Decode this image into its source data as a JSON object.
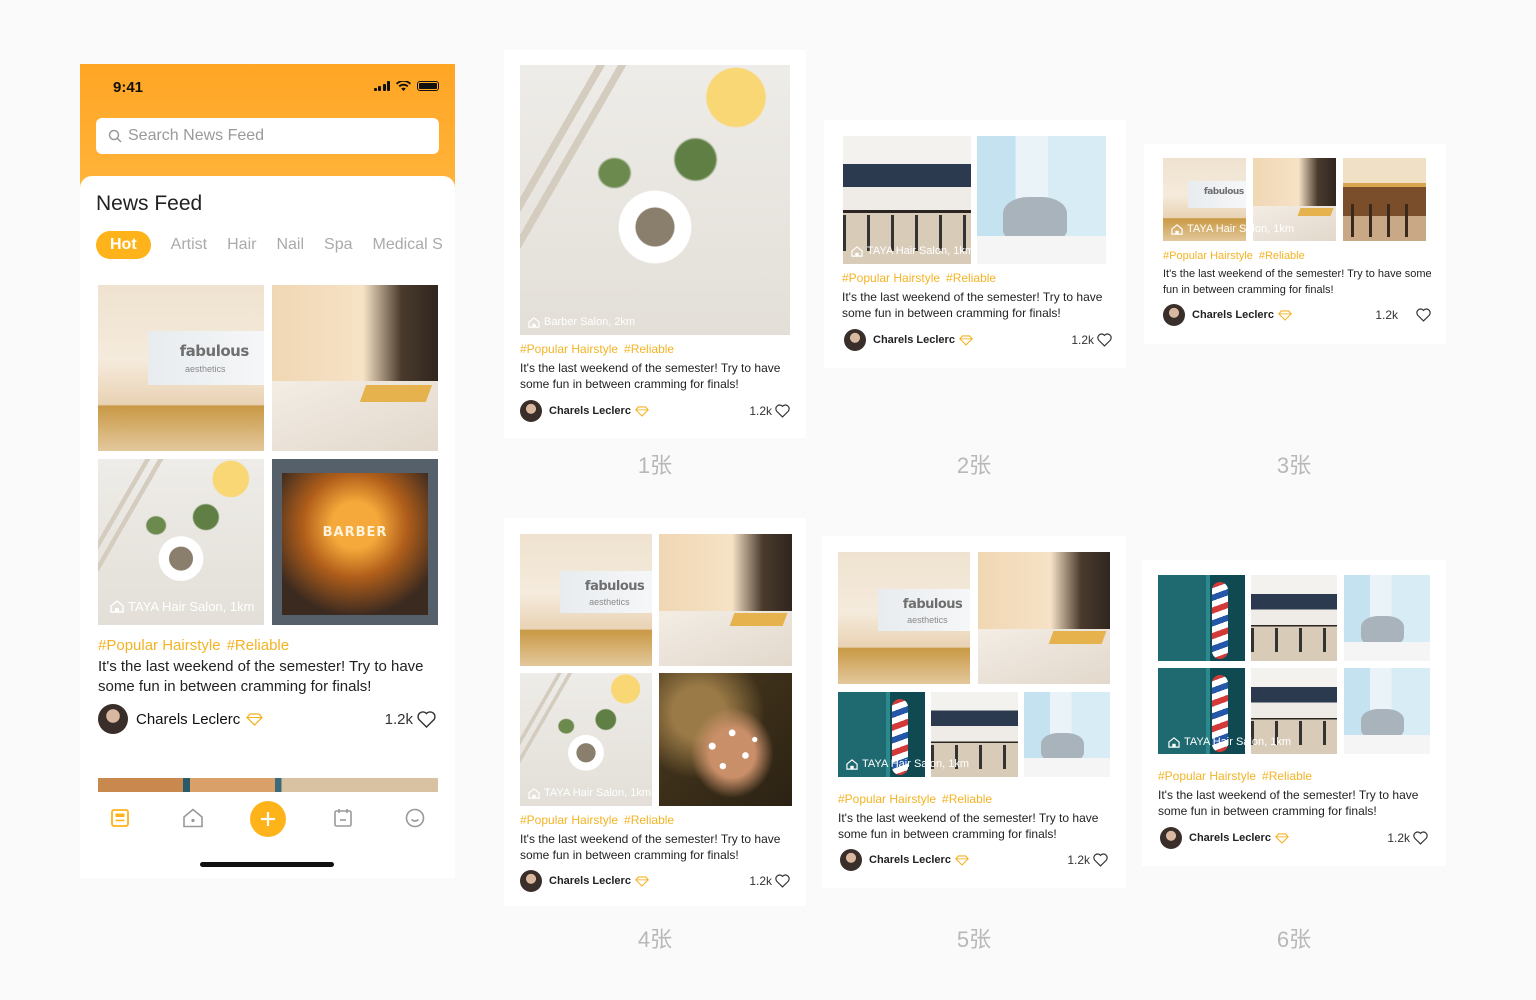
{
  "status_bar": {
    "time": "9:41"
  },
  "search": {
    "placeholder": "Search News Feed"
  },
  "feed": {
    "title": "News Feed",
    "tabs": [
      "Hot",
      "Artist",
      "Hair",
      "Nail",
      "Spa",
      "Medical S"
    ],
    "active_tab": "Hot"
  },
  "post": {
    "location": "TAYA Hair Salon, 1km",
    "tags": [
      "#Popular Hairstyle",
      "#Reliable"
    ],
    "text": "It's the last weekend of the semester! Try to have some fun in between cramming for finals!",
    "author": "Charels Leclerc",
    "likes": "1.2k"
  },
  "image_text": {
    "fabulous": "fabulous",
    "aesthetics": "aesthetics",
    "barber": "BARBER"
  },
  "bottom_nav": {
    "items": [
      {
        "name": "news-icon",
        "active": true
      },
      {
        "name": "home-icon",
        "active": false
      },
      {
        "name": "plus-icon",
        "active": false
      },
      {
        "name": "calendar-icon",
        "active": false
      },
      {
        "name": "smile-icon",
        "active": false
      }
    ]
  },
  "cards": [
    {
      "caption": "1张",
      "location": "Barber Salon, 2km",
      "tags": [
        "#Popular Hairstyle",
        "#Reliable"
      ],
      "text": "It's the last weekend of the semester! Try to have some fun in between cramming for finals!",
      "author": "Charels Leclerc",
      "likes": "1.2k"
    },
    {
      "caption": "2张",
      "location": "TAYA Hair Salon, 1km",
      "tags": [
        "#Popular Hairstyle",
        "#Reliable"
      ],
      "text": "It's the last weekend of the semester! Try to have some fun in between cramming for finals!",
      "author": "Charels Leclerc",
      "likes": "1.2k"
    },
    {
      "caption": "3张",
      "location": "TAYA Hair Salon, 1km",
      "tags": [
        "#Popular Hairstyle",
        "#Reliable"
      ],
      "text": "It's the last weekend of the semester! Try to have some fun in between cramming for finals!",
      "author": "Charels Leclerc",
      "likes": "1.2k"
    },
    {
      "caption": "4张",
      "location": "TAYA Hair Salon, 1km",
      "tags": [
        "#Popular Hairstyle",
        "#Reliable"
      ],
      "text": "It's the last weekend of the semester! Try to have some fun in between cramming for finals!",
      "author": "Charels Leclerc",
      "likes": "1.2k"
    },
    {
      "caption": "5张",
      "location": "TAYA Hair Salon, 1km",
      "tags": [
        "#Popular Hairstyle",
        "#Reliable"
      ],
      "text": "It's the last weekend of the semester! Try to have some fun in between cramming for finals!",
      "author": "Charels Leclerc",
      "likes": "1.2k"
    },
    {
      "caption": "6张",
      "location": "TAYA Hair Salon, 1km",
      "tags": [
        "#Popular Hairstyle",
        "#Reliable"
      ],
      "text": "It's the last weekend of the semester! Try to have some fun in between cramming for finals!",
      "author": "Charels Leclerc",
      "likes": "1.2k"
    }
  ],
  "colors": {
    "accent": "#ffb31a",
    "header_gradient_start": "#ffa524",
    "tag": "#f4b324",
    "caption": "#b8b8b8"
  }
}
